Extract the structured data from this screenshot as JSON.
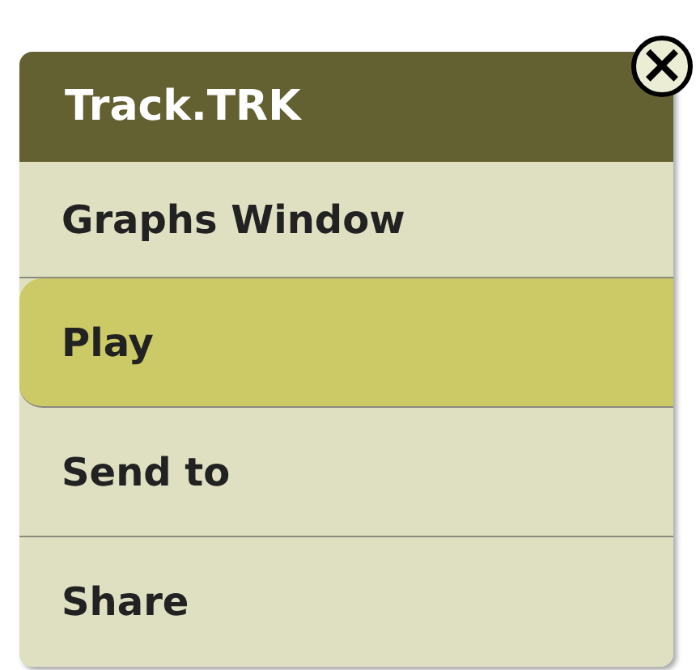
{
  "menu": {
    "title": "Track.TRK",
    "close": "×",
    "items": [
      {
        "label": "Graphs Window",
        "selected": false
      },
      {
        "label": "Play",
        "selected": true
      },
      {
        "label": "Send to",
        "selected": false
      },
      {
        "label": "Share",
        "selected": false
      }
    ]
  }
}
